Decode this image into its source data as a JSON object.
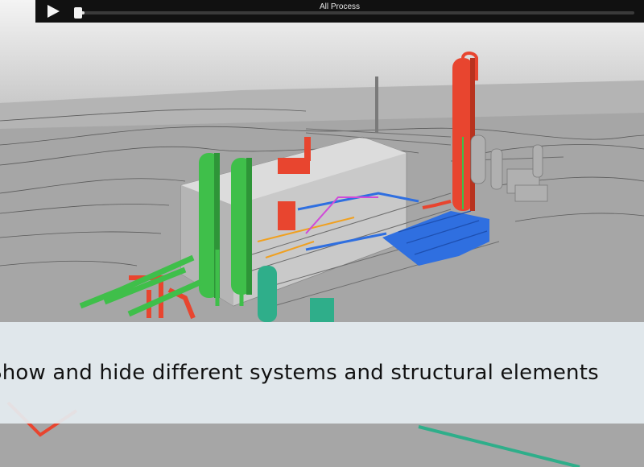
{
  "player": {
    "title": "All Process",
    "progress_fraction": 0.01
  },
  "caption": {
    "text": "Show and hide different systems and structural elements"
  },
  "icons": {
    "play": "play-icon"
  },
  "colors": {
    "bar_bg": "#111111",
    "green_system": "#3fbf4a",
    "red_system": "#e8452f",
    "blue_system": "#2f6fe0",
    "teal_system": "#2fae8a",
    "caption_bg": "#e4ecf0"
  }
}
